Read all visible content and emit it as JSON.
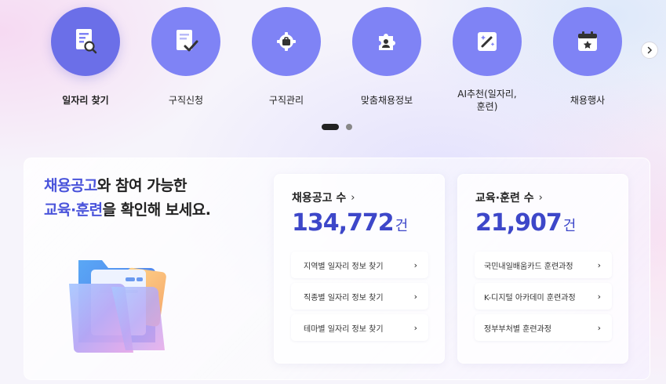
{
  "quick_menu": {
    "items": [
      {
        "label": "일자리 찾기",
        "icon": "job-search-icon",
        "active": true
      },
      {
        "label": "구직신청",
        "icon": "application-check-icon",
        "active": false
      },
      {
        "label": "구직관리",
        "icon": "briefcase-gear-icon",
        "active": false
      },
      {
        "label": "맞춤채용정보",
        "icon": "puzzle-person-icon",
        "active": false
      },
      {
        "label": "AI추천(일자리,\n훈련)",
        "icon": "magic-wand-icon",
        "active": false
      },
      {
        "label": "채용행사",
        "icon": "calendar-star-icon",
        "active": false
      }
    ],
    "next_icon": "chevron-right-icon",
    "pagination": {
      "pages": 2,
      "current": 1
    }
  },
  "headline": {
    "part1_highlight": "채용공고",
    "part1_text": "와 참여 가능한",
    "part2_highlight": "교육·훈련",
    "part2_text": "을 확인해 보세요."
  },
  "cards": {
    "jobs": {
      "title": "채용공고 수",
      "chevron": "›",
      "value": "134,772",
      "unit": "건",
      "links": [
        {
          "label": "지역별 일자리 정보 찾기"
        },
        {
          "label": "직종별 일자리 정보 찾기"
        },
        {
          "label": "테마별 일자리 정보 찾기"
        }
      ]
    },
    "training": {
      "title": "교육·훈련 수",
      "chevron": "›",
      "value": "21,907",
      "unit": "건",
      "links": [
        {
          "label": "국민내일배움카드 훈련과정"
        },
        {
          "label": "K-디지털 아카데미 훈련과정"
        },
        {
          "label": "정부부처별 훈련과정"
        }
      ]
    }
  },
  "colors": {
    "accent": "#4a54db",
    "circle": "#7f83f5",
    "stat_value": "#3d47c9"
  }
}
